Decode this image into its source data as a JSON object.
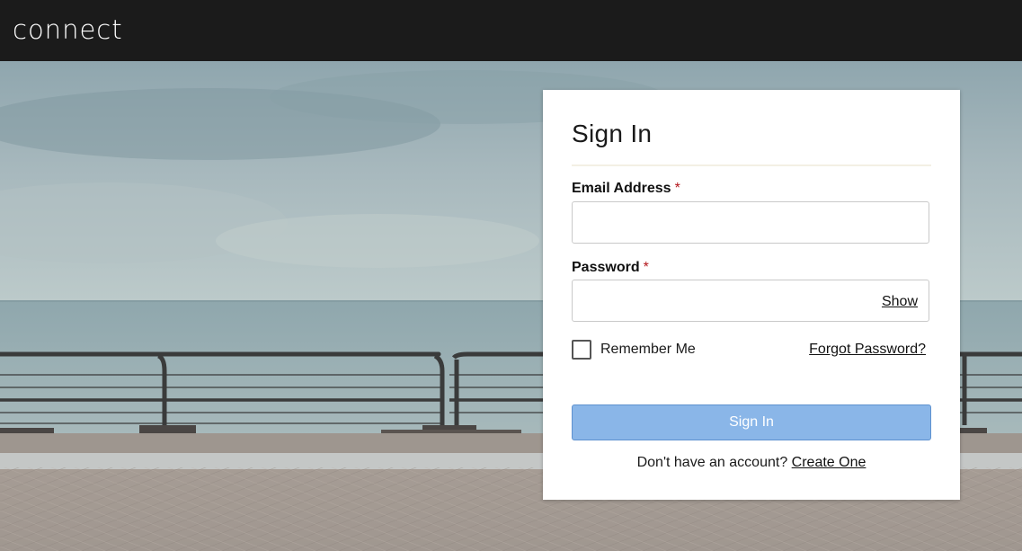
{
  "header": {
    "logo_text": "connect"
  },
  "signin": {
    "title": "Sign In",
    "email_label": "Email Address",
    "email_value": "",
    "password_label": "Password",
    "password_value": "",
    "required_marker": "*",
    "show_label": "Show",
    "remember_label": "Remember Me",
    "remember_checked": false,
    "forgot_label": "Forgot Password?",
    "submit_label": "Sign In",
    "no_account_text": "Don't have an account?",
    "create_label": "Create One"
  },
  "colors": {
    "topbar": "#1b1b1b",
    "primary_button": "#8ab6e8",
    "required": "#b3161b"
  }
}
